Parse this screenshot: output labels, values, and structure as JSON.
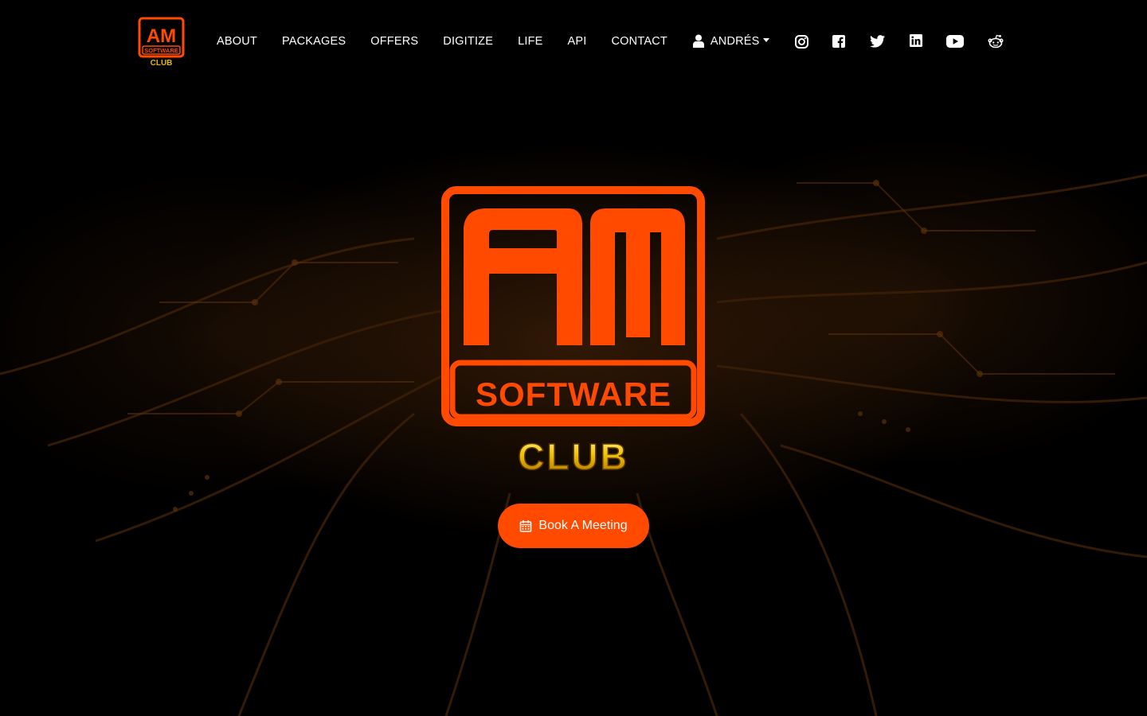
{
  "brand": {
    "logo_top": "AM",
    "logo_middle": "SOFTWARE",
    "logo_bottom": "CLUB",
    "accent_color": "#ff4a00",
    "gold_color": "#e8b600"
  },
  "nav": {
    "links": [
      {
        "label": "ABOUT"
      },
      {
        "label": "PACKAGES"
      },
      {
        "label": "OFFERS"
      },
      {
        "label": "DIGITIZE"
      },
      {
        "label": "LIFE"
      },
      {
        "label": "API"
      },
      {
        "label": "CONTACT"
      }
    ],
    "user_label": "ANDRÉS",
    "user_icon": "user-icon"
  },
  "social": [
    {
      "icon": "instagram-icon"
    },
    {
      "icon": "facebook-icon"
    },
    {
      "icon": "twitter-icon"
    },
    {
      "icon": "linkedin-icon"
    },
    {
      "icon": "youtube-icon"
    },
    {
      "icon": "reddit-icon"
    }
  ],
  "hero": {
    "cta_label": "Book A Meeting",
    "cta_icon": "calendar-icon"
  }
}
